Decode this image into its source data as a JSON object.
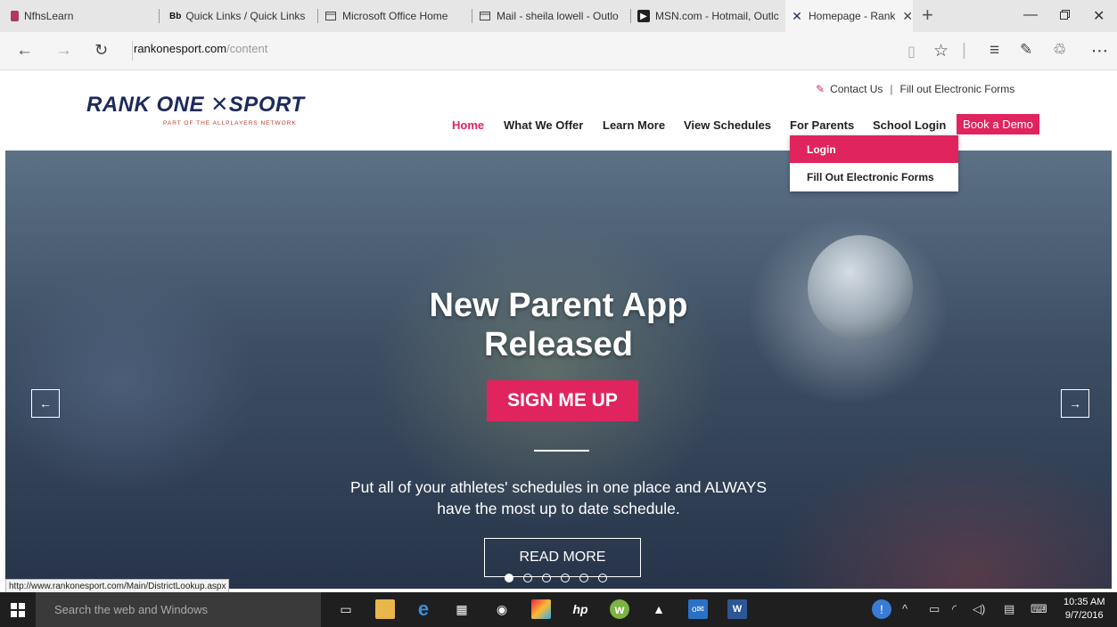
{
  "browser": {
    "tabs": [
      {
        "label": "NfhsLearn",
        "icon": "nfhs-icon"
      },
      {
        "label": "Quick Links / Quick Links",
        "icon": "blackboard-icon",
        "prefix": "Bb"
      },
      {
        "label": "Microsoft Office Home",
        "icon": "page-icon"
      },
      {
        "label": "Mail - sheila lowell - Outlo",
        "icon": "page-icon"
      },
      {
        "label": "MSN.com - Hotmail, Outlc",
        "icon": "msn-icon"
      },
      {
        "label": "Homepage - Rank On",
        "icon": "rankone-icon",
        "active": true
      }
    ],
    "url_host": "rankonesport.com",
    "url_path": "/content",
    "status_url": "http://www.rankonesport.com/Main/DistrictLookup.aspx"
  },
  "site": {
    "logo_text": "RANK ONE",
    "logo_text2": "SPORT",
    "logo_tagline": "PART OF THE ALLPLAYERS NETWORK",
    "top_links": {
      "contact": "Contact Us",
      "separator": "|",
      "forms": "Fill out Electronic Forms"
    },
    "menu": [
      "Home",
      "What We Offer",
      "Learn More",
      "View Schedules",
      "For Parents",
      "School Login"
    ],
    "demo_button": "Book a Demo",
    "dropdown": [
      "Login",
      "Fill Out Electronic Forms"
    ],
    "accent_color": "#e0245e"
  },
  "hero": {
    "title_line1": "New Parent App",
    "title_line2": "Released",
    "cta": "SIGN ME UP",
    "desc_line1": "Put all of your athletes' schedules in one place and ALWAYS",
    "desc_line2": "have the most up to date schedule.",
    "read_more": "READ MORE",
    "slide_count": 6,
    "active_slide": 1
  },
  "taskbar": {
    "search_placeholder": "Search the web and Windows",
    "time": "10:35 AM",
    "date": "9/7/2016"
  }
}
